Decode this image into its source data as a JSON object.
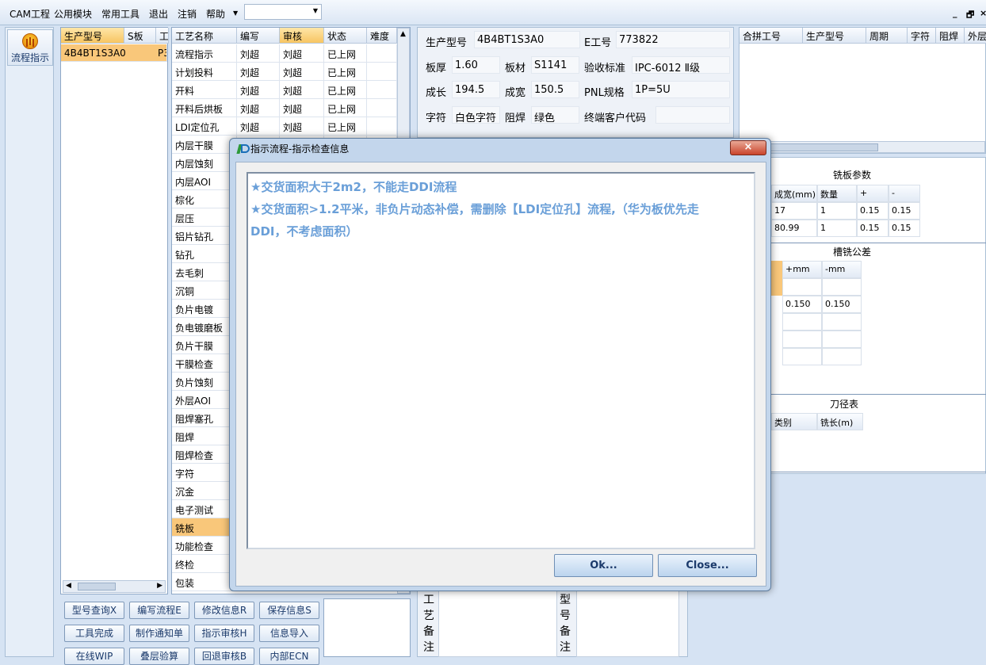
{
  "menubar": {
    "items": [
      "CAM工程",
      "公用模块",
      "常用工具",
      "退出",
      "注销",
      "帮助"
    ],
    "combo_value": "",
    "min": "_",
    "restore": "🗗",
    "close": "×"
  },
  "leftnav": {
    "label": "流程指示"
  },
  "product_grid": {
    "headers": [
      "生产型号",
      "S板",
      "工"
    ],
    "row": [
      "4B4BT1S3A0",
      "P3"
    ]
  },
  "process_grid": {
    "headers": [
      "工艺名称",
      "编写",
      "审核",
      "状态",
      "难度"
    ],
    "rows": [
      [
        "流程指示",
        "刘超",
        "刘超",
        "已上网"
      ],
      [
        "计划投料",
        "刘超",
        "刘超",
        "已上网"
      ],
      [
        "开料",
        "刘超",
        "刘超",
        "已上网"
      ],
      [
        "开料后烘板",
        "刘超",
        "刘超",
        "已上网"
      ],
      [
        "LDI定位孔",
        "刘超",
        "刘超",
        "已上网"
      ],
      [
        "内层干膜"
      ],
      [
        "内层蚀刻"
      ],
      [
        "内层AOI"
      ],
      [
        "棕化"
      ],
      [
        "层压"
      ],
      [
        "铝片钻孔"
      ],
      [
        "钻孔"
      ],
      [
        "去毛刺"
      ],
      [
        "沉铜"
      ],
      [
        "负片电镀"
      ],
      [
        "负电镀磨板"
      ],
      [
        "负片干膜"
      ],
      [
        "干膜检查"
      ],
      [
        "负片蚀刻"
      ],
      [
        "外层AOI"
      ],
      [
        "阻焊塞孔"
      ],
      [
        "阻焊"
      ],
      [
        "阻焊检查"
      ],
      [
        "字符"
      ],
      [
        "沉金"
      ],
      [
        "电子测试"
      ],
      [
        "铣板"
      ],
      [
        "功能检查"
      ],
      [
        "终检"
      ],
      [
        "包装"
      ]
    ]
  },
  "buttons": [
    [
      "型号查询X",
      "编写流程E",
      "修改信息R",
      "保存信息S"
    ],
    [
      "工具完成",
      "制作通知单",
      "指示审核H",
      "信息导入"
    ],
    [
      "在线WIP",
      "叠层验算",
      "回退审核B",
      "内部ECN"
    ]
  ],
  "info": {
    "prod_label": "生产型号",
    "prod": "4B4BT1S3A0",
    "e_label": "E工号",
    "e": "773822",
    "thick_label": "板厚",
    "thick": "1.60",
    "mat_label": "板材",
    "mat": "S1141",
    "std_label": "验收标准",
    "std": "IPC-6012 Ⅱ级",
    "len_label": "成长",
    "len": "194.5",
    "wid_label": "成宽",
    "wid": "150.5",
    "pnl_label": "PNL规格",
    "pnl": "1P=5U",
    "char_label": "字符",
    "char": "白色字符",
    "mask_label": "阻焊",
    "mask": "绿色",
    "cust_label": "终端客户代码",
    "cust": ""
  },
  "merge_grid": {
    "headers": [
      "合拼工号",
      "生产型号",
      "周期",
      "字符",
      "阻焊",
      "外层"
    ]
  },
  "mill_params": {
    "title": "铣板参数",
    "headers": [
      "成宽(mm)",
      "数量",
      "+",
      "-"
    ],
    "rows": [
      [
        "17",
        "1",
        "0.15",
        "0.15"
      ],
      [
        "80.99",
        "1",
        "0.15",
        "0.15"
      ]
    ]
  },
  "slot_tol": {
    "title": "槽铣公差",
    "headers": [
      "+mm",
      "-mm"
    ],
    "row": [
      "0.150",
      "0.150"
    ]
  },
  "tool_table": {
    "title": "刀径表",
    "headers": [
      "类别",
      "铣长(m)"
    ]
  },
  "vertical_labels": {
    "left": [
      "工",
      "艺",
      "备",
      "注"
    ],
    "right": [
      "型",
      "号",
      "备",
      "注"
    ]
  },
  "dialog": {
    "title": "指示流程-指示检查信息",
    "close": "×",
    "line1": "★交货面积大于2m2，不能走DDI流程",
    "line2": "★交货面积>1.2平米，非负片动态补偿，需删除【LDI定位孔】流程,（华为板优先走",
    "line3": "DDI，不考虑面积）",
    "ok": "Ok...",
    "close_btn": "Close..."
  }
}
